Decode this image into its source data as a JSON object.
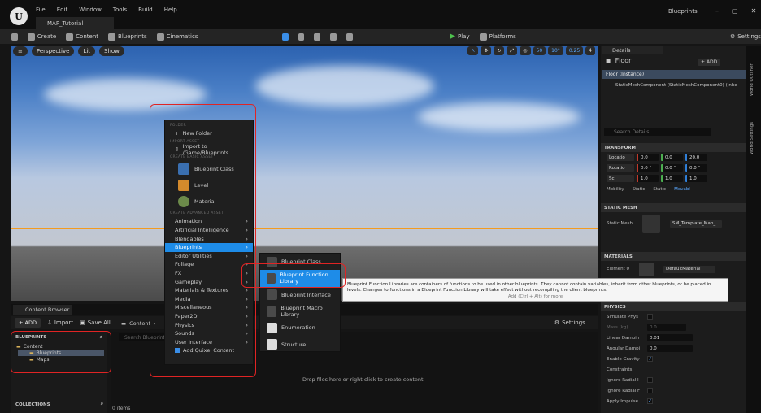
{
  "window": {
    "project": "Blueprints",
    "map_tab": "MAP_Tutorial",
    "menu": [
      "File",
      "Edit",
      "Window",
      "Tools",
      "Build",
      "Help"
    ],
    "controls": [
      "–",
      "▢",
      "✕"
    ]
  },
  "toolbar": {
    "create": "Create",
    "content": "Content",
    "blueprints": "Blueprints",
    "cinematics": "Cinematics",
    "play": "Play",
    "platforms": "Platforms",
    "settings": "Settings"
  },
  "viewport": {
    "perspective": "Perspective",
    "lit": "Lit",
    "show": "Show",
    "grid": "50",
    "angle": "10°",
    "scale": "0.25",
    "cam": "4"
  },
  "context_menu": {
    "sections": {
      "folder": "FOLDER",
      "import": "IMPORT ASSET",
      "basic": "CREATE BASIC ASSET",
      "advanced": "CREATE ADVANCED ASSET"
    },
    "new_folder": "New Folder",
    "import_to": "Import to /Game/Blueprints...",
    "basic_assets": [
      "Blueprint Class",
      "Level",
      "Material"
    ],
    "advanced_items": [
      "Animation",
      "Artificial Intelligence",
      "Blendables",
      "Blueprints",
      "Editor Utilities",
      "Foliage",
      "FX",
      "Gameplay",
      "Materials & Textures",
      "Media",
      "Miscellaneous",
      "Paper2D",
      "Physics",
      "Sounds",
      "User Interface"
    ],
    "quixel": "Add Quixel Content"
  },
  "submenu": [
    "Blueprint Class",
    "Blueprint Function Library",
    "Blueprint Interface",
    "Blueprint Macro Library",
    "Enumeration",
    "Structure"
  ],
  "tooltip": {
    "text": "Blueprint Function Libraries are containers of functions to be used in other blueprints. They cannot contain variables, inherit from other blueprints, or be placed in levels. Changes to functions in a Blueprint Function Library will take effect without recompiling the client blueprints.",
    "hint": "Add (Ctrl + Alt) for more"
  },
  "content_browser": {
    "tab": "Content Browser",
    "add": "ADD",
    "import": "Import",
    "save_all": "Save All",
    "crumb_content": "Content",
    "crumb_sep": "›",
    "search_placeholder": "Search Blueprints",
    "settings": "Settings",
    "blueprints_header": "BLUEPRINTS",
    "tree": [
      "Content",
      "Blueprints",
      "Maps"
    ],
    "collections": "COLLECTIONS",
    "drop_text": "Drop files here or right click to create content.",
    "items": "0 items"
  },
  "details": {
    "tab": "Details",
    "title": "Floor",
    "add": "ADD",
    "instance": "Floor (Instance)",
    "component": "StaticMeshComponent (StaticMeshComponent0) (Inhe",
    "search": "Search Details",
    "transform": {
      "header": "TRANSFORM",
      "rows": [
        {
          "label": "Locatio",
          "v": [
            "0.0",
            "0.0",
            "20.0"
          ]
        },
        {
          "label": "Rotatio",
          "v": [
            "0.0 °",
            "0.0 °",
            "0.0 °"
          ]
        },
        {
          "label": "Sc",
          "v": [
            "1.0",
            "1.0",
            "1.0"
          ]
        }
      ],
      "mobility": "Mobility",
      "static": "Static",
      "stationary": "Static",
      "movable": "Movabl"
    },
    "static_mesh": {
      "header": "STATIC MESH",
      "label": "Static Mesh",
      "value": "SM_Template_Map_"
    },
    "materials": {
      "header": "MATERIALS",
      "label": "Element 0",
      "value": "DefaultMaterial"
    },
    "physics": {
      "header": "PHYSICS",
      "rows": [
        "Simulate Phys",
        "Mass (kg)",
        "Linear Dampin",
        "Angular Dampi",
        "Enable Gravity",
        "Constraints",
        "Ignore Radial I",
        "Ignore Radial F",
        "Apply Impulse"
      ],
      "mass": "0.0",
      "linear": "0.01",
      "angular": "0.0"
    }
  },
  "side_labels": [
    "World Outliner",
    "World Settings"
  ]
}
